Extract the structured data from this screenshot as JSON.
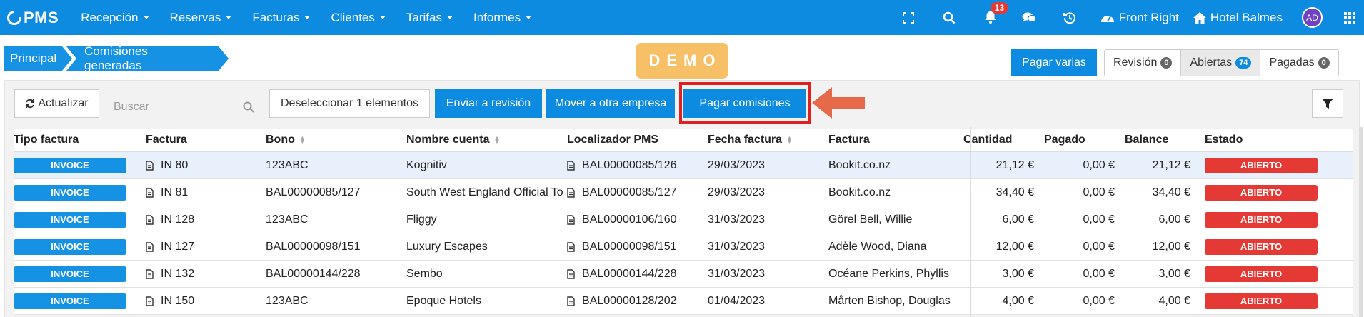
{
  "nav": {
    "logo": "PMS",
    "menu": [
      {
        "label": "Recepción"
      },
      {
        "label": "Reservas"
      },
      {
        "label": "Facturas"
      },
      {
        "label": "Clientes"
      },
      {
        "label": "Tarifas"
      },
      {
        "label": "Informes"
      }
    ],
    "notifications_count": "13",
    "front_label": "Front Right",
    "hotel_label": "Hotel Balmes",
    "avatar_initials": "AD",
    "brand_color": "#0d8be0"
  },
  "breadcrumb": {
    "home": "Principal",
    "current": "Comisiones generadas"
  },
  "demo_label": "DEMO",
  "header_actions": {
    "pay_multiple": "Pagar varias",
    "tabs": [
      {
        "label": "Revisión",
        "count": "0"
      },
      {
        "label": "Abiertas",
        "count": "74"
      },
      {
        "label": "Pagadas",
        "count": "0"
      }
    ]
  },
  "toolbar": {
    "refresh": "Actualizar",
    "search_placeholder": "Buscar",
    "deselect": "Deseleccionar 1 elementos",
    "send_review": "Enviar a revisión",
    "move_company": "Mover a otra empresa",
    "pay_commissions": "Pagar comisiones"
  },
  "table": {
    "headers": {
      "tipo": "Tipo factura",
      "factura": "Factura",
      "bono": "Bono",
      "nombre": "Nombre cuenta",
      "localizador": "Localizador PMS",
      "fecha": "Fecha factura",
      "factura2": "Factura",
      "cantidad": "Cantidad",
      "pagado": "Pagado",
      "balance": "Balance",
      "estado": "Estado"
    },
    "rows": [
      {
        "tipo": "INVOICE",
        "factura": "IN 80",
        "bono": "123ABC",
        "nombre": "Kognitiv",
        "localizador": "BAL00000085/126",
        "fecha": "29/03/2023",
        "factura2": "Bookit.co.nz",
        "cantidad": "21,12 €",
        "pagado": "0,00 €",
        "balance": "21,12 €",
        "estado": "ABIERTO"
      },
      {
        "tipo": "INVOICE",
        "factura": "IN 81",
        "bono": "BAL00000085/127",
        "nombre": "South West England Official To",
        "localizador": "BAL00000085/127",
        "fecha": "29/03/2023",
        "factura2": "Bookit.co.nz",
        "cantidad": "34,40 €",
        "pagado": "0,00 €",
        "balance": "34,40 €",
        "estado": "ABIERTO"
      },
      {
        "tipo": "INVOICE",
        "factura": "IN 128",
        "bono": "123ABC",
        "nombre": "Fliggy",
        "localizador": "BAL00000106/160",
        "fecha": "31/03/2023",
        "factura2": "Görel Bell, Willie",
        "cantidad": "6,00 €",
        "pagado": "0,00 €",
        "balance": "6,00 €",
        "estado": "ABIERTO"
      },
      {
        "tipo": "INVOICE",
        "factura": "IN 127",
        "bono": "BAL00000098/151",
        "nombre": "Luxury Escapes",
        "localizador": "BAL00000098/151",
        "fecha": "31/03/2023",
        "factura2": "Adèle Wood, Diana",
        "cantidad": "12,00 €",
        "pagado": "0,00 €",
        "balance": "12,00 €",
        "estado": "ABIERTO"
      },
      {
        "tipo": "INVOICE",
        "factura": "IN 132",
        "bono": "BAL00000144/228",
        "nombre": "Sembo",
        "localizador": "BAL00000144/228",
        "fecha": "31/03/2023",
        "factura2": "Océane Perkins, Phyllis",
        "cantidad": "3,00 €",
        "pagado": "0,00 €",
        "balance": "3,00 €",
        "estado": "ABIERTO"
      },
      {
        "tipo": "INVOICE",
        "factura": "IN 150",
        "bono": "123ABC",
        "nombre": "Epoque Hotels",
        "localizador": "BAL00000128/202",
        "fecha": "01/04/2023",
        "factura2": "Mårten Bishop, Douglas",
        "cantidad": "4,00 €",
        "pagado": "0,00 €",
        "balance": "4,00 €",
        "estado": "ABIERTO"
      }
    ]
  }
}
